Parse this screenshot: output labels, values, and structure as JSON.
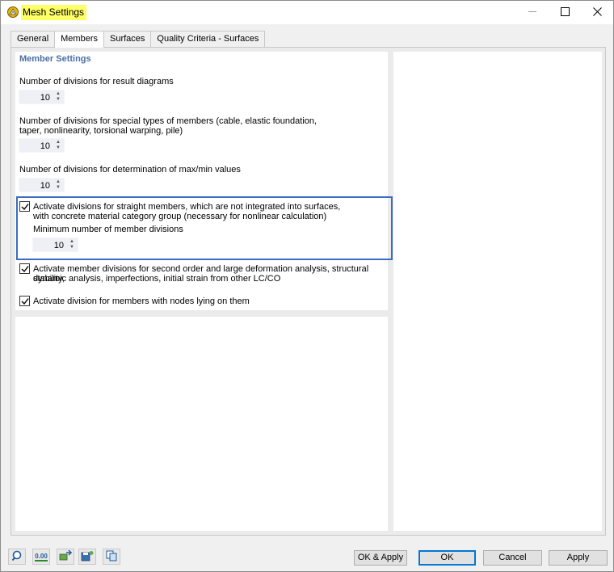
{
  "window": {
    "title": "Mesh Settings"
  },
  "tabs": [
    {
      "label": "General",
      "active": false
    },
    {
      "label": "Members",
      "active": true
    },
    {
      "label": "Surfaces",
      "active": false
    },
    {
      "label": "Quality Criteria - Surfaces",
      "active": false
    }
  ],
  "member_settings": {
    "title": "Member Settings",
    "result_diagrams": {
      "label": "Number of divisions for result diagrams",
      "value": "10"
    },
    "special_types": {
      "label_line1": "Number of divisions for special types of members (cable, elastic foundation,",
      "label_line2": "taper, nonlinearity, torsional warping, pile)",
      "value": "10"
    },
    "max_min": {
      "label": "Number of divisions for determination of max/min values",
      "value": "10"
    },
    "straight_members": {
      "checked": true,
      "label_line1": "Activate divisions for straight members, which are not integrated into surfaces,",
      "label_line2": "with concrete material category group (necessary for nonlinear calculation)",
      "min_label": "Minimum number of member divisions",
      "min_value": "10"
    },
    "second_order": {
      "checked": true,
      "label_line1": "Activate member divisions for second order and large deformation analysis, structural stability,",
      "label_line2": "dynamic analysis, imperfections, initial strain from other LC/CO"
    },
    "nodes_on_members": {
      "checked": true,
      "label": "Activate division for members with nodes lying on them"
    }
  },
  "footer": {
    "icons": [
      "help-icon",
      "units-icon",
      "export-icon",
      "save-defaults-icon",
      "copy-icon"
    ],
    "units_text": "0.00",
    "ok_apply": "OK & Apply",
    "ok": "OK",
    "cancel": "Cancel",
    "apply": "Apply"
  },
  "colors": {
    "title_highlight": "#ffff66",
    "section_title": "#4a6fa5",
    "focus_border": "#3b6cc0"
  }
}
